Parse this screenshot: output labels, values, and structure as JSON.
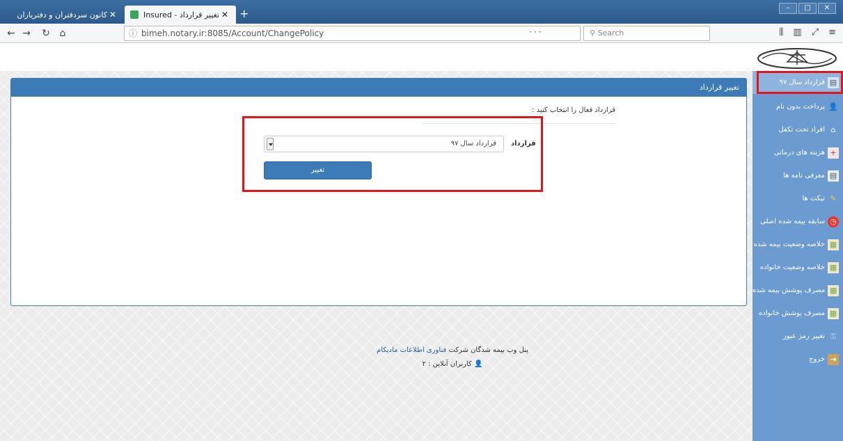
{
  "browser": {
    "tabs": [
      {
        "title": "کانون سردفتران و دفتریاران",
        "active": false
      },
      {
        "title": "تغییر قرارداد - Madycom Insured",
        "active": true
      }
    ],
    "url": "bimeh.notary.ir:8085/Account/ChangePolicy",
    "search_placeholder": "Search",
    "url_extra": "···",
    "new_tab": "+",
    "close_glyph": "✕"
  },
  "panel": {
    "title": "تغییر قرارداد",
    "instruction": "قرارداد فعال را انتخاب کنید :",
    "field_label": "قرارداد",
    "select_value": "قرارداد سال ۹۷",
    "button_label": "تغییر"
  },
  "footer": {
    "prefix": "پنل وب بیمه شدگان شرکت",
    "company": "فناوری اطلاعات مادیکام",
    "online": "کاربران آنلاین : ۲"
  },
  "sidebar": {
    "items": [
      {
        "label": "قرارداد سال ۹۷",
        "icon": "document-icon",
        "active": true
      },
      {
        "label": "پرداخت بدون نام",
        "icon": "user-icon",
        "active": false
      },
      {
        "label": "افراد تحت تکفل",
        "icon": "family-icon",
        "active": false
      },
      {
        "label": "هزینه های درمانی",
        "icon": "medical-icon",
        "active": false
      },
      {
        "label": "معرفی نامه ها",
        "icon": "letter-icon",
        "active": false
      },
      {
        "label": "تیکت ها",
        "icon": "ticket-icon",
        "active": false
      },
      {
        "label": "سابقه بیمه شده اصلی",
        "icon": "clock-icon",
        "active": false
      },
      {
        "label": "خلاصه وضعیت بیمه شده",
        "icon": "report-icon",
        "active": false
      },
      {
        "label": "خلاصه وضعیت خانواده",
        "icon": "report-icon",
        "active": false
      },
      {
        "label": "مصرف پوشش بیمه شده",
        "icon": "report-icon",
        "active": false
      },
      {
        "label": "مصرف پوشش خانواده",
        "icon": "report-icon",
        "active": false
      },
      {
        "label": "تغییر رمز عبور",
        "icon": "key-icon",
        "active": false
      },
      {
        "label": "خروج",
        "icon": "exit-icon",
        "active": false
      }
    ]
  },
  "colors": {
    "primary": "#3c7ab8",
    "sidebar": "#6b9bd0",
    "highlight": "#e0161b"
  }
}
